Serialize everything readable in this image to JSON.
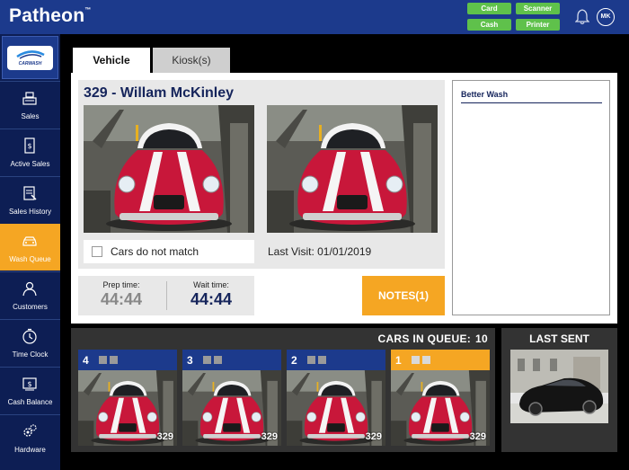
{
  "header": {
    "brand": "Patheon",
    "trademark": "™",
    "status": [
      {
        "label": "Card",
        "color": "#5fc14b"
      },
      {
        "label": "Scanner",
        "color": "#5fc14b"
      },
      {
        "label": "Cash",
        "color": "#5fc14b"
      },
      {
        "label": "Printer",
        "color": "#5fc14b"
      }
    ],
    "user_initials": "MK"
  },
  "sidebar": {
    "logo_text": "CARWASH",
    "items": [
      {
        "label": "Sales",
        "icon": "register-icon"
      },
      {
        "label": "Active Sales",
        "icon": "receipt-icon"
      },
      {
        "label": "Sales History",
        "icon": "history-icon"
      },
      {
        "label": "Wash Queue",
        "icon": "car-icon",
        "active": true
      },
      {
        "label": "Customers",
        "icon": "person-icon"
      },
      {
        "label": "Time Clock",
        "icon": "clock-icon"
      },
      {
        "label": "Cash Balance",
        "icon": "cash-icon"
      },
      {
        "label": "Hardware",
        "icon": "gears-icon"
      }
    ]
  },
  "tabs": [
    {
      "label": "Vehicle",
      "active": true
    },
    {
      "label": "Kiosk(s)",
      "active": false
    }
  ],
  "vehicle": {
    "title": "329 - Willam McKinley",
    "mismatch_label": "Cars do not match",
    "mismatch_checked": false,
    "last_visit": "Last Visit:  01/01/2019",
    "prep_label": "Prep time:",
    "prep_value": "44:44",
    "wait_label": "Wait time:",
    "wait_value": "44:44",
    "notes_label": "NOTES(1)"
  },
  "wash_panel": {
    "title": "Better Wash"
  },
  "queue": {
    "title": "CARS IN QUEUE:",
    "count": "10",
    "cards": [
      {
        "position": "4",
        "car_id": "329"
      },
      {
        "position": "3",
        "car_id": "329"
      },
      {
        "position": "2",
        "car_id": "329"
      },
      {
        "position": "1",
        "car_id": "329"
      }
    ]
  },
  "last_sent": {
    "title": "LAST SENT"
  },
  "colors": {
    "brand_blue": "#1c3a8c",
    "nav_dark": "#0d1e54",
    "accent_orange": "#f5a623",
    "status_green": "#5fc14b",
    "text_navy": "#15245b"
  }
}
